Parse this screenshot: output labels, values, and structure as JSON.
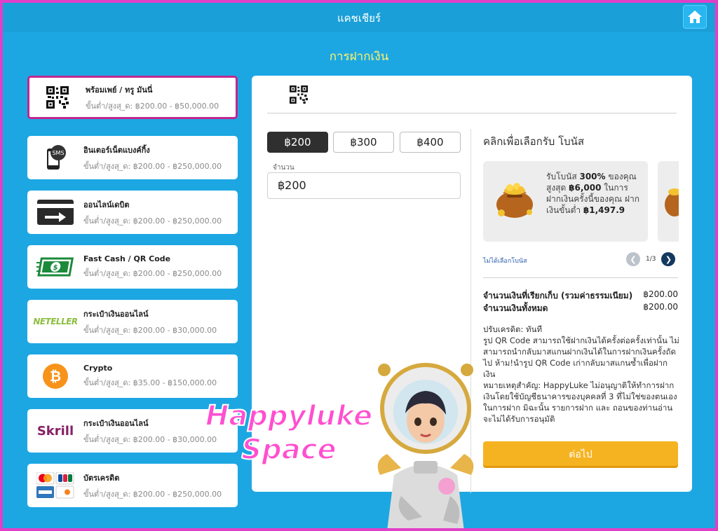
{
  "header": {
    "title": "แคชเชียร์"
  },
  "page": {
    "title": "การฝากเงิน"
  },
  "methods": [
    {
      "name": "พร้อมเพย์ / ทรู มันนี่",
      "range": "ขั้นต่ำ/สูงสุ_ด: ฿200.00 - ฿50,000.00",
      "icon": "qr-code-icon"
    },
    {
      "name": "อินเตอร์เน็ตแบงค์กิ้ง",
      "range": "ขั้นต่ำ/สูงสุ_ด: ฿200.00 - ฿250,000.00",
      "icon": "sms-phone-icon"
    },
    {
      "name": "ออนไลน์เดบิต",
      "range": "ขั้นต่ำ/สูงสุ_ด: ฿200.00 - ฿250,000.00",
      "icon": "card-arrow-icon"
    },
    {
      "name": "Fast Cash / QR Code",
      "range": "ขั้นต่ำ/สูงสุ_ด: ฿200.00 - ฿250,000.00",
      "icon": "cash-icon"
    },
    {
      "name": "กระเป๋าเงินออนไลน์",
      "range": "ขั้นต่ำ/สูงสุ_ด: ฿200.00 - ฿30,000.00",
      "icon": "neteller-logo",
      "logo_text": "NETELLER"
    },
    {
      "name": "Crypto",
      "range": "ขั้นต่ำ/สูงสุ_ด: ฿35.00 - ฿150,000.00",
      "icon": "bitcoin-icon",
      "logo_text": "₿"
    },
    {
      "name": "กระเป๋าเงินออนไลน์",
      "range": "ขั้นต่ำ/สูงสุ_ด: ฿200.00 - ฿30,000.00",
      "icon": "skrill-logo",
      "logo_text": "Skrill"
    },
    {
      "name": "บัตรเครดิต",
      "range": "ขั้นต่ำ/สูงสุ_ด: ฿200.00 - ฿250,000.00",
      "icon": "credit-cards-icon"
    }
  ],
  "amounts": {
    "opt1": "฿200",
    "opt2": "฿300",
    "opt3": "฿400",
    "label": "จำนวน",
    "value": "฿200"
  },
  "bonus": {
    "title": "คลิกเพื่อเลือกรับ โบนัส",
    "line_pre": "รับโบนัส ",
    "percent": "300%",
    "line_mid": " ของคุณ สูงสุด ",
    "max": "฿6,000",
    "line_post": " ในการฝากเงินครั้งนี้ของคุณ ฝากเงินขั้นต่ำ ",
    "min": "฿1,497.9",
    "no_bonus": "ไม่ได้เลือกโบนัส",
    "page": "1/3"
  },
  "summary": {
    "fee_label": "จำนวนเงินที่เรียกเก็บ (รวมค่าธรรมเนียม)",
    "fee_value": "฿200.00",
    "total_label": "จำนวนเงินทั้งหมด",
    "total_value": "฿200.00"
  },
  "notes": {
    "l1": "ปรับเครดิต: ทันที",
    "l2": "รูป QR Code สามารถใช้ฝากเงินได้ครั้งต่อครั้งเท่านั้น ไม่สามารถนำกลับมาสแกนฝากเงินได้ในการฝากเงินครั้งถัดไป ห้าม!นำรูป QR Code เก่ากลับมาสแกนซ้ำเพื่อฝากเงิน",
    "l3": "หมายเหตุสำคัญ: HappyLuke ไม่อนุญาติให้ทำการฝากเงินโดยใช้บัญชีธนาคารของบุคคลที่ 3 ที่ไม่ใช่ของตนเองในการฝาก มิฉะนั้น รายการฝาก และ ถอนของท่านอ่านจะไม่ได้รับการอนุมัติ"
  },
  "next_label": "ต่อไป",
  "promo": {
    "line1": "Happyluke",
    "line2": "Space"
  },
  "colors": {
    "background": "#1ca7e3",
    "accent_yellow": "#fff36a",
    "button_orange": "#f6b321",
    "active_border": "#c0278f"
  }
}
